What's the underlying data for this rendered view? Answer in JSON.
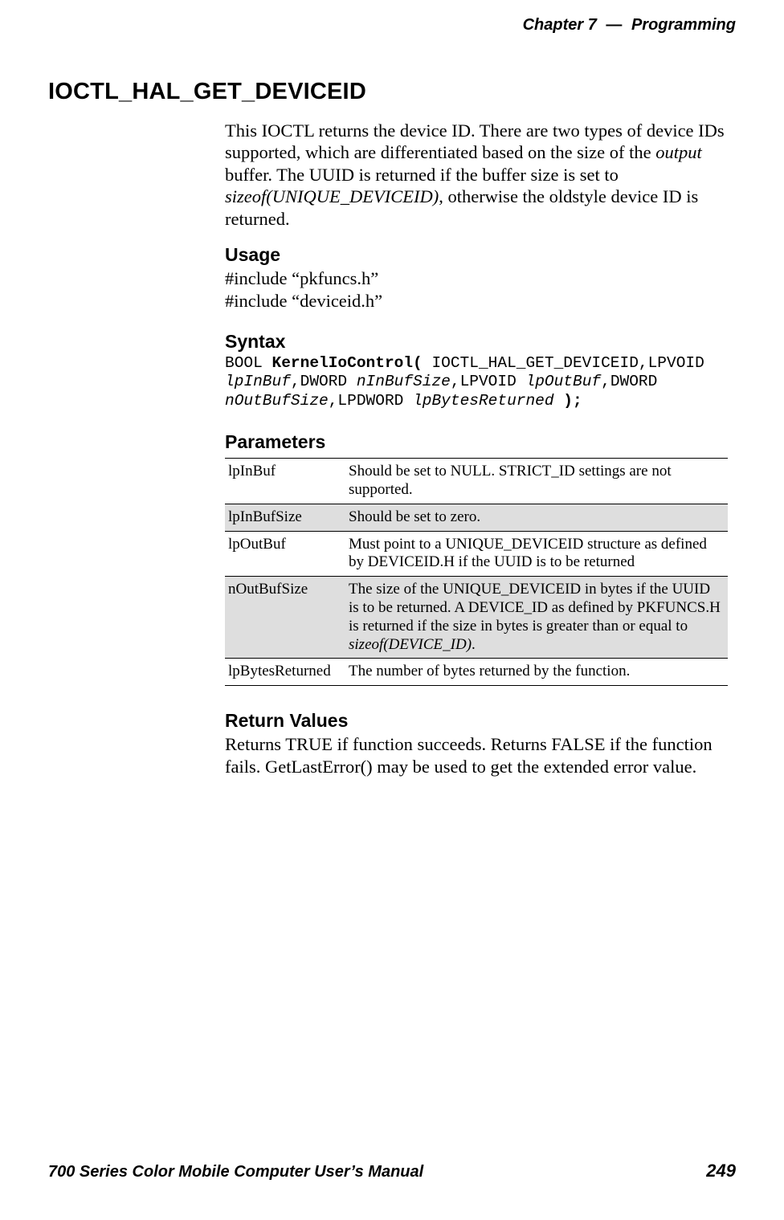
{
  "header": {
    "chapter": "Chapter",
    "chapter_num": "7",
    "dash": "—",
    "section": "Programming"
  },
  "h1": "IOCTL_HAL_GET_DEVICEID",
  "intro": {
    "p1a": "This IOCTL returns the device ID. There are two types of device IDs supported, which are differentiated based on the size of the ",
    "p1_ital1": "output",
    "p1b": " buffer. The UUID is returned if the buffer size is set to ",
    "p1_ital2": "sizeof(UNIQUE_DEVICEID)",
    "p1c": ", otherwise the oldstyle device ID is returned."
  },
  "usage": {
    "heading": "Usage",
    "line1": "#include “pkfuncs.h”",
    "line2": "#include “deviceid.h”"
  },
  "syntax": {
    "heading": "Syntax",
    "t1": "BOOL ",
    "b1": "KernelIoControl(",
    "t2": " IOCTL_HAL_GET_DEVICEID,LPVOID ",
    "i1": "lpInBuf",
    "t3": ",DWORD ",
    "i2": "nInBufSize",
    "t4": ",LPVOID ",
    "i3": "lpOutBuf",
    "t5": ",DWORD ",
    "i4": "nOutBufSize",
    "t6": ",LPDWORD ",
    "i5": "lpBytesReturned",
    "t7": " ",
    "b2": ");"
  },
  "parameters": {
    "heading": "Parameters",
    "rows": [
      {
        "name": "lpInBuf",
        "desc_plain": "Should be set to NULL. STRICT_ID settings are not supported.",
        "shaded": false
      },
      {
        "name": "lpInBufSize",
        "desc_plain": "Should be set to zero.",
        "shaded": true
      },
      {
        "name": "lpOutBuf",
        "desc_plain": "Must point to a UNIQUE_DEVICEID structure as defined by DEVICEID.H if the UUID is to be returned",
        "shaded": false
      },
      {
        "name": "nOutBufSize",
        "desc_pre": "The size of the UNIQUE_DEVICEID in bytes if the UUID is to be returned. A DEVICE_ID as defined by PKFUNCS.H is returned if the size in bytes is greater than or equal to ",
        "desc_ital": "sizeof(DEVICE_ID)",
        "desc_post": ".",
        "shaded": true
      },
      {
        "name": "lpBytesReturned",
        "desc_plain": "The number of bytes returned by the function.",
        "shaded": false
      }
    ]
  },
  "return": {
    "heading": "Return Values",
    "text": "Returns TRUE if function succeeds. Returns FALSE if the function fails. GetLastError() may be used to get the extended error value."
  },
  "footer": {
    "title": "700 Series Color Mobile Computer User’s Manual",
    "page": "249"
  }
}
